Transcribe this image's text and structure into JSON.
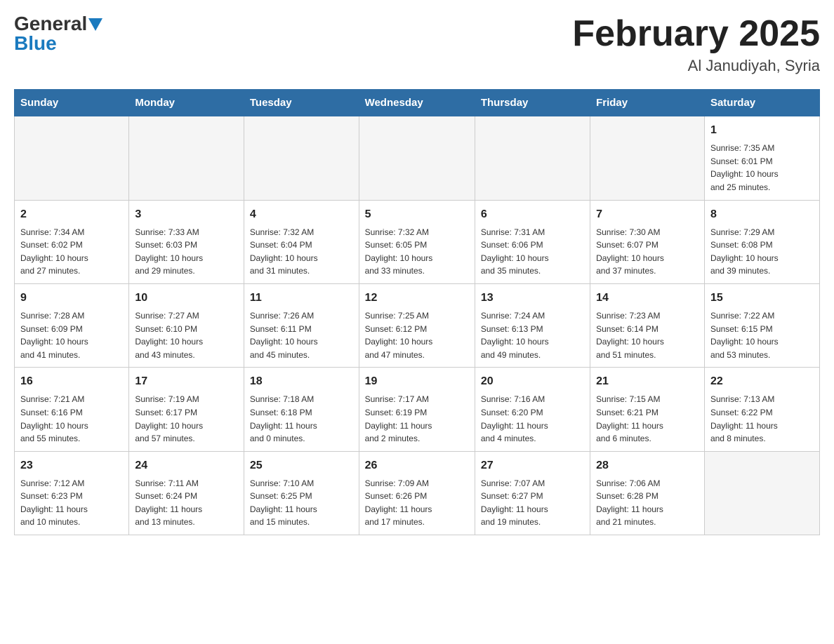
{
  "header": {
    "logo_general": "General",
    "logo_blue": "Blue",
    "month_title": "February 2025",
    "location": "Al Janudiyah, Syria"
  },
  "weekdays": [
    "Sunday",
    "Monday",
    "Tuesday",
    "Wednesday",
    "Thursday",
    "Friday",
    "Saturday"
  ],
  "weeks": [
    [
      {
        "day": "",
        "info": ""
      },
      {
        "day": "",
        "info": ""
      },
      {
        "day": "",
        "info": ""
      },
      {
        "day": "",
        "info": ""
      },
      {
        "day": "",
        "info": ""
      },
      {
        "day": "",
        "info": ""
      },
      {
        "day": "1",
        "info": "Sunrise: 7:35 AM\nSunset: 6:01 PM\nDaylight: 10 hours\nand 25 minutes."
      }
    ],
    [
      {
        "day": "2",
        "info": "Sunrise: 7:34 AM\nSunset: 6:02 PM\nDaylight: 10 hours\nand 27 minutes."
      },
      {
        "day": "3",
        "info": "Sunrise: 7:33 AM\nSunset: 6:03 PM\nDaylight: 10 hours\nand 29 minutes."
      },
      {
        "day": "4",
        "info": "Sunrise: 7:32 AM\nSunset: 6:04 PM\nDaylight: 10 hours\nand 31 minutes."
      },
      {
        "day": "5",
        "info": "Sunrise: 7:32 AM\nSunset: 6:05 PM\nDaylight: 10 hours\nand 33 minutes."
      },
      {
        "day": "6",
        "info": "Sunrise: 7:31 AM\nSunset: 6:06 PM\nDaylight: 10 hours\nand 35 minutes."
      },
      {
        "day": "7",
        "info": "Sunrise: 7:30 AM\nSunset: 6:07 PM\nDaylight: 10 hours\nand 37 minutes."
      },
      {
        "day": "8",
        "info": "Sunrise: 7:29 AM\nSunset: 6:08 PM\nDaylight: 10 hours\nand 39 minutes."
      }
    ],
    [
      {
        "day": "9",
        "info": "Sunrise: 7:28 AM\nSunset: 6:09 PM\nDaylight: 10 hours\nand 41 minutes."
      },
      {
        "day": "10",
        "info": "Sunrise: 7:27 AM\nSunset: 6:10 PM\nDaylight: 10 hours\nand 43 minutes."
      },
      {
        "day": "11",
        "info": "Sunrise: 7:26 AM\nSunset: 6:11 PM\nDaylight: 10 hours\nand 45 minutes."
      },
      {
        "day": "12",
        "info": "Sunrise: 7:25 AM\nSunset: 6:12 PM\nDaylight: 10 hours\nand 47 minutes."
      },
      {
        "day": "13",
        "info": "Sunrise: 7:24 AM\nSunset: 6:13 PM\nDaylight: 10 hours\nand 49 minutes."
      },
      {
        "day": "14",
        "info": "Sunrise: 7:23 AM\nSunset: 6:14 PM\nDaylight: 10 hours\nand 51 minutes."
      },
      {
        "day": "15",
        "info": "Sunrise: 7:22 AM\nSunset: 6:15 PM\nDaylight: 10 hours\nand 53 minutes."
      }
    ],
    [
      {
        "day": "16",
        "info": "Sunrise: 7:21 AM\nSunset: 6:16 PM\nDaylight: 10 hours\nand 55 minutes."
      },
      {
        "day": "17",
        "info": "Sunrise: 7:19 AM\nSunset: 6:17 PM\nDaylight: 10 hours\nand 57 minutes."
      },
      {
        "day": "18",
        "info": "Sunrise: 7:18 AM\nSunset: 6:18 PM\nDaylight: 11 hours\nand 0 minutes."
      },
      {
        "day": "19",
        "info": "Sunrise: 7:17 AM\nSunset: 6:19 PM\nDaylight: 11 hours\nand 2 minutes."
      },
      {
        "day": "20",
        "info": "Sunrise: 7:16 AM\nSunset: 6:20 PM\nDaylight: 11 hours\nand 4 minutes."
      },
      {
        "day": "21",
        "info": "Sunrise: 7:15 AM\nSunset: 6:21 PM\nDaylight: 11 hours\nand 6 minutes."
      },
      {
        "day": "22",
        "info": "Sunrise: 7:13 AM\nSunset: 6:22 PM\nDaylight: 11 hours\nand 8 minutes."
      }
    ],
    [
      {
        "day": "23",
        "info": "Sunrise: 7:12 AM\nSunset: 6:23 PM\nDaylight: 11 hours\nand 10 minutes."
      },
      {
        "day": "24",
        "info": "Sunrise: 7:11 AM\nSunset: 6:24 PM\nDaylight: 11 hours\nand 13 minutes."
      },
      {
        "day": "25",
        "info": "Sunrise: 7:10 AM\nSunset: 6:25 PM\nDaylight: 11 hours\nand 15 minutes."
      },
      {
        "day": "26",
        "info": "Sunrise: 7:09 AM\nSunset: 6:26 PM\nDaylight: 11 hours\nand 17 minutes."
      },
      {
        "day": "27",
        "info": "Sunrise: 7:07 AM\nSunset: 6:27 PM\nDaylight: 11 hours\nand 19 minutes."
      },
      {
        "day": "28",
        "info": "Sunrise: 7:06 AM\nSunset: 6:28 PM\nDaylight: 11 hours\nand 21 minutes."
      },
      {
        "day": "",
        "info": ""
      }
    ]
  ]
}
